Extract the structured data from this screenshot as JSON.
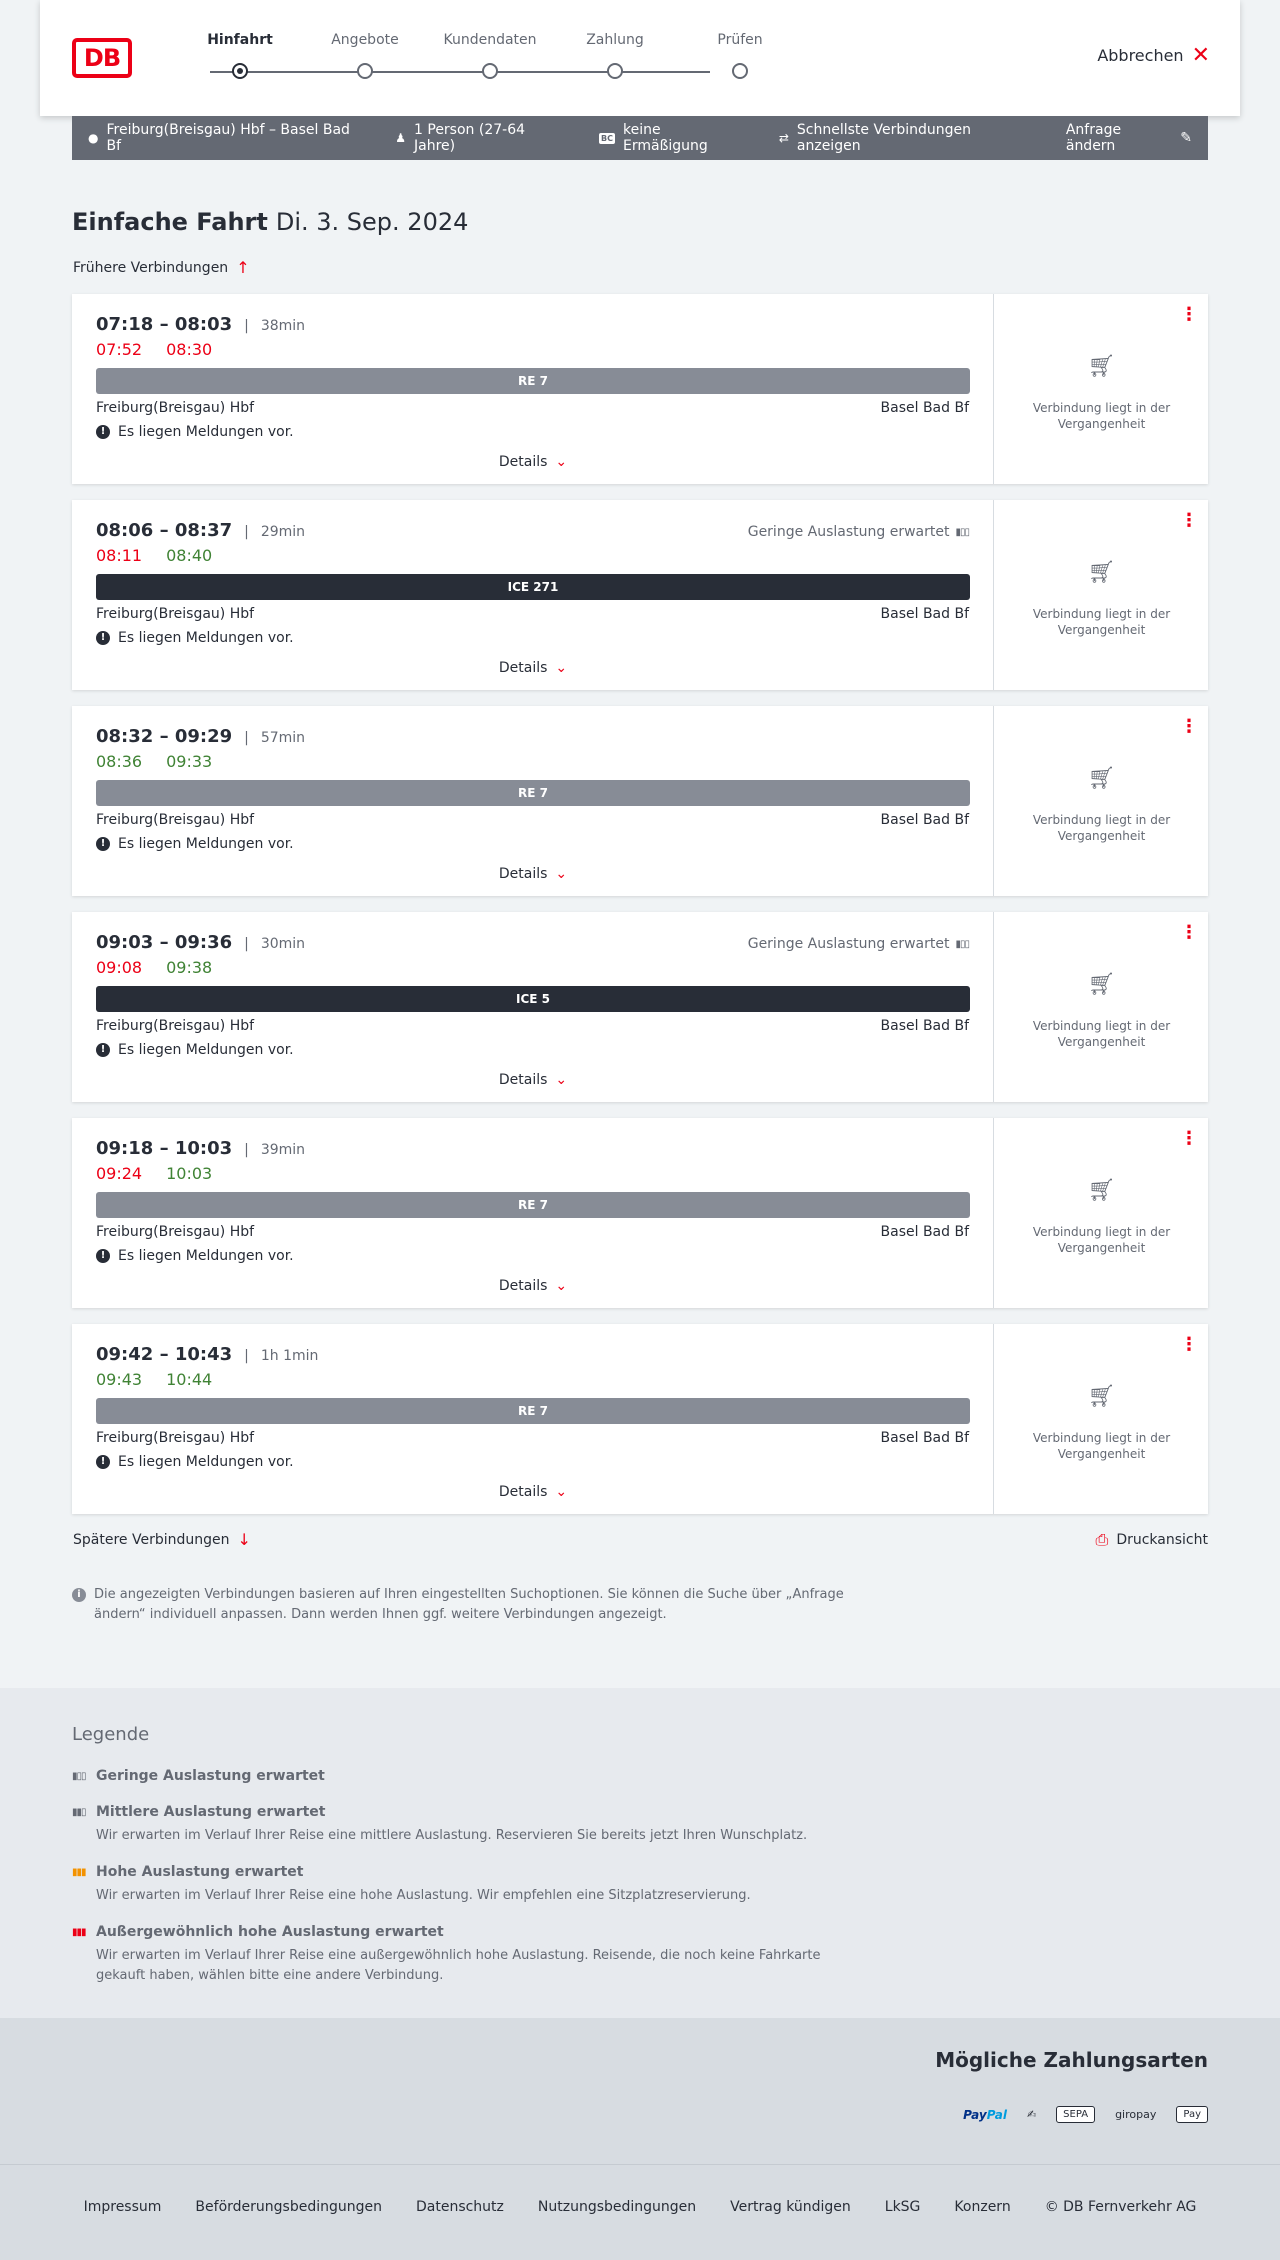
{
  "header": {
    "logo_text": "DB",
    "steps": [
      {
        "label": "Hinfahrt"
      },
      {
        "label": "Angebote"
      },
      {
        "label": "Kundendaten"
      },
      {
        "label": "Zahlung"
      },
      {
        "label": "Prüfen"
      }
    ],
    "active_step": "Hinfahrt",
    "abort_label": "Abbrechen"
  },
  "query": {
    "route": "Freiburg(Breisgau) Hbf – Basel Bad Bf",
    "passengers": "1 Person (27-64 Jahre)",
    "discount": "keine Ermäßigung",
    "discount_badge": "BC",
    "fastest": "Schnellste Verbindungen anzeigen",
    "change_label": "Anfrage ändern"
  },
  "page": {
    "title": "Einfache Fahrt",
    "date": "Di. 3. Sep. 2024",
    "earlier_label": "Frühere Verbindungen",
    "later_label": "Spätere Verbindungen",
    "print_label": "Druckansicht",
    "info_text": "Die angezeigten Verbindungen basieren auf Ihren eingestellten Suchoptionen. Sie können die Suche über „Anfrage ändern“ individuell anpassen. Dann werden Ihnen ggf. weitere Verbindungen angezeigt."
  },
  "connections": [
    {
      "times": "07:18 – 08:03",
      "duration": "38min",
      "rt_dep": "07:52",
      "rt_arr": "08:30",
      "occupancy": "",
      "train": "RE 7",
      "from": "Freiburg(Breisgau) Hbf",
      "to": "Basel Bad Bf",
      "message": "Es liegen Meldungen vor.",
      "details": "Details",
      "status": "Verbindung liegt in der Vergangenheit"
    },
    {
      "times": "08:06 – 08:37",
      "duration": "29min",
      "rt_dep": "08:11",
      "rt_arr": "08:40",
      "occupancy": "Geringe Auslastung erwartet",
      "train": "ICE 271",
      "from": "Freiburg(Breisgau) Hbf",
      "to": "Basel Bad Bf",
      "message": "Es liegen Meldungen vor.",
      "details": "Details",
      "status": "Verbindung liegt in der Vergangenheit"
    },
    {
      "times": "08:32 – 09:29",
      "duration": "57min",
      "rt_dep": "08:36",
      "rt_arr": "09:33",
      "occupancy": "",
      "train": "RE 7",
      "from": "Freiburg(Breisgau) Hbf",
      "to": "Basel Bad Bf",
      "message": "Es liegen Meldungen vor.",
      "details": "Details",
      "status": "Verbindung liegt in der Vergangenheit"
    },
    {
      "times": "09:03 – 09:36",
      "duration": "30min",
      "rt_dep": "09:08",
      "rt_arr": "09:38",
      "occupancy": "Geringe Auslastung erwartet",
      "train": "ICE 5",
      "from": "Freiburg(Breisgau) Hbf",
      "to": "Basel Bad Bf",
      "message": "Es liegen Meldungen vor.",
      "details": "Details",
      "status": "Verbindung liegt in der Vergangenheit"
    },
    {
      "times": "09:18 – 10:03",
      "duration": "39min",
      "rt_dep": "09:24",
      "rt_arr": "10:03",
      "occupancy": "",
      "train": "RE 7",
      "from": "Freiburg(Breisgau) Hbf",
      "to": "Basel Bad Bf",
      "message": "Es liegen Meldungen vor.",
      "details": "Details",
      "status": "Verbindung liegt in der Vergangenheit"
    },
    {
      "times": "09:42 – 10:43",
      "duration": "1h 1min",
      "rt_dep": "09:43",
      "rt_arr": "10:44",
      "occupancy": "",
      "train": "RE 7",
      "from": "Freiburg(Breisgau) Hbf",
      "to": "Basel Bad Bf",
      "message": "Es liegen Meldungen vor.",
      "details": "Details",
      "status": "Verbindung liegt in der Vergangenheit"
    }
  ],
  "legend": {
    "title": "Legende",
    "items": [
      {
        "title": "Geringe Auslastung erwartet",
        "desc": ""
      },
      {
        "title": "Mittlere Auslastung erwartet",
        "desc": "Wir erwarten im Verlauf Ihrer Reise eine mittlere Auslastung. Reservieren Sie bereits jetzt Ihren Wunschplatz."
      },
      {
        "title": "Hohe Auslastung erwartet",
        "desc": "Wir erwarten im Verlauf Ihrer Reise eine hohe Auslastung. Wir empfehlen eine Sitzplatzreservierung."
      },
      {
        "title": "Außergewöhnlich hohe Auslastung erwartet",
        "desc": "Wir erwarten im Verlauf Ihrer Reise eine außergewöhnlich hohe Auslastung. Reisende, die noch keine Fahrkarte gekauft haben, wählen bitte eine andere Verbindung."
      }
    ]
  },
  "payment": {
    "title": "Mögliche Zahlungsarten",
    "methods": [
      "PayPal",
      "SEPA",
      "giropay",
      "Pay"
    ]
  },
  "footer": {
    "links": [
      "Impressum",
      "Beförderungsbedingungen",
      "Datenschutz",
      "Nutzungsbedingungen",
      "Vertrag kündigen",
      "LkSG",
      "Konzern",
      "© DB Fernverkehr AG"
    ]
  },
  "colors": {
    "brand_red": "#ec0016",
    "delay_red": "#ec0016",
    "ontime_green": "#408335",
    "re_bar": "#878c96",
    "ice_bar": "#282d37",
    "querybar": "#646973"
  }
}
